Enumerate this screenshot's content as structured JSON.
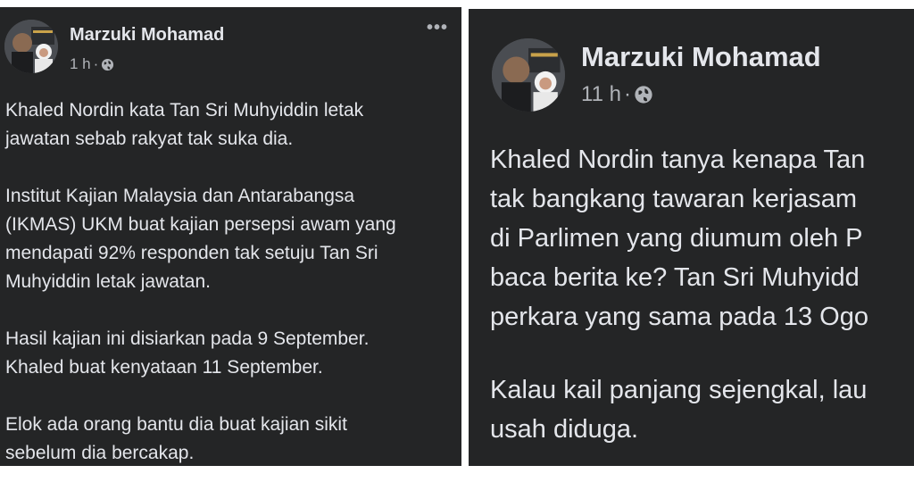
{
  "posts": [
    {
      "author": "Marzuki Mohamad",
      "time": "1 h",
      "separator": "·",
      "privacy_icon": "globe-icon",
      "more_icon": "more-horizontal-icon",
      "more_label": "•••",
      "paragraphs": [
        [
          "Khaled Nordin kata Tan Sri Muhyiddin letak",
          "jawatan sebab rakyat tak suka dia."
        ],
        [
          "Institut Kajian Malaysia dan Antarabangsa",
          "(IKMAS) UKM buat kajian persepsi awam yang",
          "mendapati 92% responden tak setuju Tan Sri",
          "Muhyiddin letak jawatan."
        ],
        [
          "Hasil kajian ini disiarkan pada 9 September.",
          "Khaled buat kenyataan 11 September."
        ],
        [
          "Elok ada orang bantu dia buat kajian sikit",
          "sebelum dia bercakap."
        ]
      ]
    },
    {
      "author": "Marzuki Mohamad",
      "time": "11 h",
      "separator": "·",
      "privacy_icon": "globe-icon",
      "paragraphs": [
        [
          "Khaled Nordin tanya kenapa Tan",
          "tak bangkang tawaran kerjasam",
          "di Parlimen yang diumum oleh P",
          "baca berita ke? Tan Sri Muhyidd",
          "perkara yang sama pada 13 Ogo"
        ],
        [
          "Kalau kail panjang sejengkal, lau",
          "usah diduga."
        ]
      ]
    }
  ],
  "colors": {
    "panel_bg": "#242526",
    "text_primary": "#e4e6eb",
    "text_secondary": "#b0b3b8",
    "page_bg": "#ffffff"
  }
}
